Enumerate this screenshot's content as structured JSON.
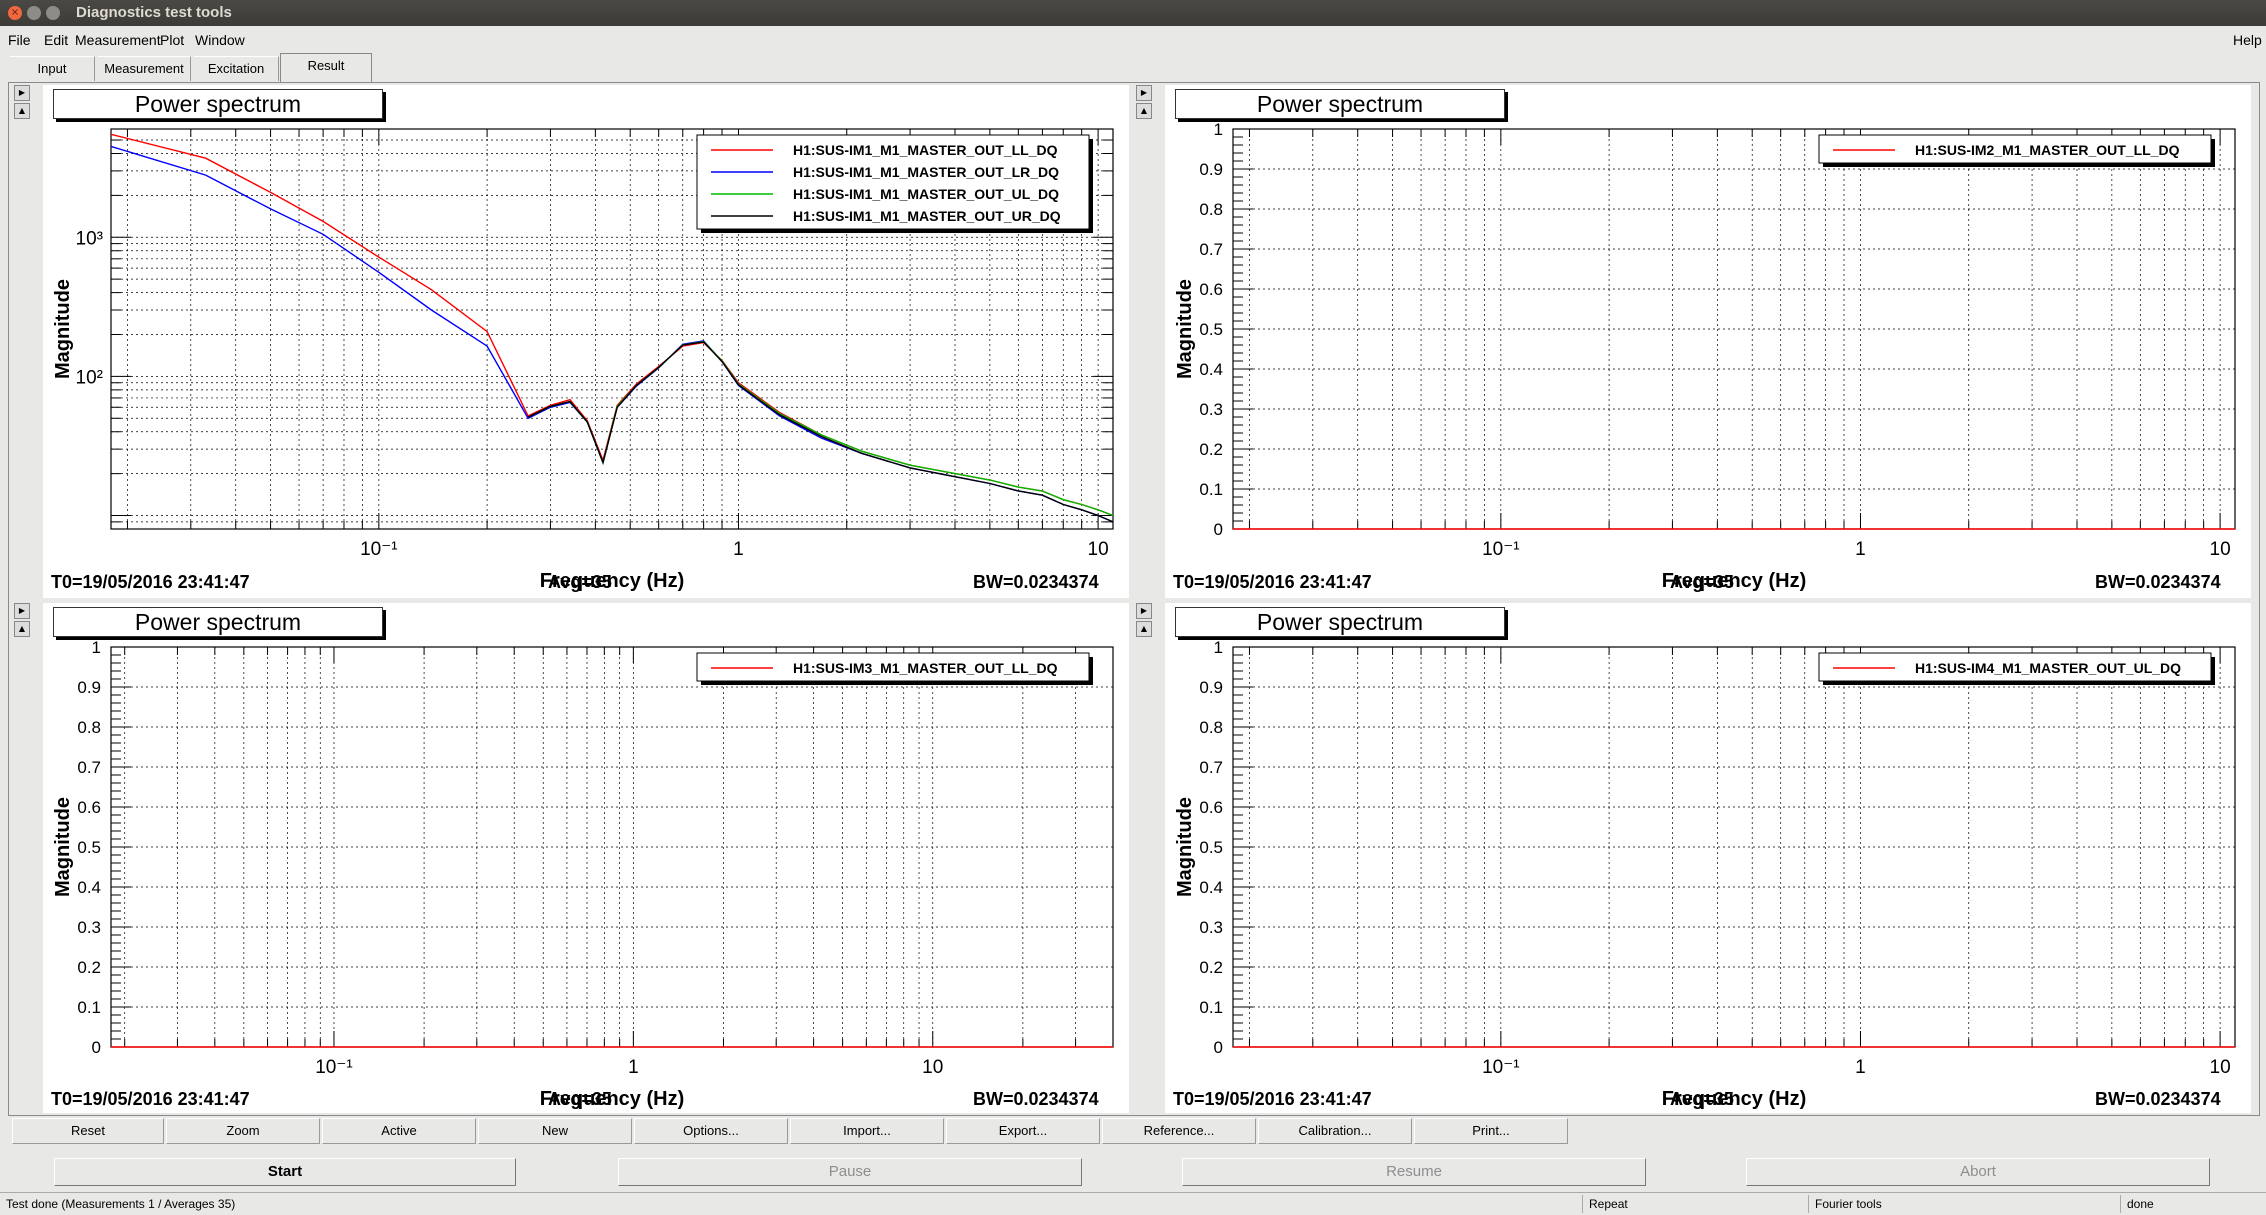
{
  "window": {
    "title": "Diagnostics test tools"
  },
  "menu": {
    "items": [
      "File",
      "Edit",
      "Measurement",
      "Plot",
      "Window"
    ],
    "help": "Help"
  },
  "tabs": [
    "Input",
    "Measurement",
    "Excitation",
    "Result"
  ],
  "active_tab": "Result",
  "pads": [
    {
      "title": "Power spectrum",
      "ylabel": "Magnitude",
      "xlabel": "Frequency (Hz)",
      "t0": "T0=19/05/2016 23:41:47",
      "avg": "Avg=35",
      "bw": "BW=0.0234374",
      "legend": [
        "H1:SUS-IM1_M1_MASTER_OUT_LL_DQ",
        "H1:SUS-IM1_M1_MASTER_OUT_LR_DQ",
        "H1:SUS-IM1_M1_MASTER_OUT_UL_DQ",
        "H1:SUS-IM1_M1_MASTER_OUT_UR_DQ"
      ],
      "xticks": [
        "10⁻¹",
        "1",
        "10"
      ],
      "yticks": [
        "10³",
        "10²"
      ]
    },
    {
      "title": "Power spectrum",
      "ylabel": "Magnitude",
      "xlabel": "Frequency (Hz)",
      "t0": "T0=19/05/2016 23:41:47",
      "avg": "Avg=35",
      "bw": "BW=0.0234374",
      "legend": [
        "H1:SUS-IM2_M1_MASTER_OUT_LL_DQ"
      ],
      "xticks": [
        "10⁻¹",
        "1",
        "10"
      ],
      "yticks": [
        "0",
        "0.1",
        "0.2",
        "0.3",
        "0.4",
        "0.5",
        "0.6",
        "0.7",
        "0.8",
        "0.9",
        "1"
      ]
    },
    {
      "title": "Power spectrum",
      "ylabel": "Magnitude",
      "xlabel": "Frequency (Hz)",
      "t0": "T0=19/05/2016 23:41:47",
      "avg": "Avg=35",
      "bw": "BW=0.0234374",
      "legend": [
        "H1:SUS-IM3_M1_MASTER_OUT_LL_DQ"
      ],
      "xticks": [
        "10⁻¹",
        "1",
        "10"
      ],
      "yticks": [
        "0",
        "0.1",
        "0.2",
        "0.3",
        "0.4",
        "0.5",
        "0.6",
        "0.7",
        "0.8",
        "0.9",
        "1"
      ]
    },
    {
      "title": "Power spectrum",
      "ylabel": "Magnitude",
      "xlabel": "Frequency (Hz)",
      "t0": "T0=19/05/2016 23:41:47",
      "avg": "Avg=35",
      "bw": "BW=0.0234374",
      "legend": [
        "H1:SUS-IM4_M1_MASTER_OUT_UL_DQ"
      ],
      "xticks": [
        "10⁻¹",
        "1",
        "10"
      ],
      "yticks": [
        "0",
        "0.1",
        "0.2",
        "0.3",
        "0.4",
        "0.5",
        "0.6",
        "0.7",
        "0.8",
        "0.9",
        "1"
      ]
    }
  ],
  "chart_data": [
    {
      "type": "line",
      "title": "Power spectrum",
      "xlabel": "Frequency (Hz)",
      "ylabel": "Magnitude",
      "xscale": "log",
      "yscale": "log",
      "xlim": [
        0.018,
        11
      ],
      "ylim": [
        8,
        6000
      ],
      "grid": true,
      "legend_position": "top-right",
      "series": [
        {
          "name": "H1:SUS-IM1_M1_MASTER_OUT_LL_DQ",
          "color": "#ff0000",
          "x": [
            0.018,
            0.033,
            0.05,
            0.07,
            0.1,
            0.14,
            0.2,
            0.26,
            0.3,
            0.34,
            0.38,
            0.42,
            0.46,
            0.52,
            0.6,
            0.7,
            0.8,
            0.9,
            1.0,
            1.3,
            1.7,
            2.2,
            3,
            4,
            5,
            6,
            7,
            8,
            9,
            10,
            11
          ],
          "y": [
            5500,
            3700,
            2100,
            1300,
            720,
            420,
            210,
            52,
            62,
            68,
            48,
            25,
            62,
            88,
            118,
            165,
            175,
            130,
            90,
            55,
            38,
            29,
            23,
            20,
            18,
            16,
            15,
            13,
            12,
            11,
            10
          ]
        },
        {
          "name": "H1:SUS-IM1_M1_MASTER_OUT_LR_DQ",
          "color": "#0000ff",
          "x": [
            0.018,
            0.033,
            0.05,
            0.07,
            0.1,
            0.14,
            0.2,
            0.26,
            0.3,
            0.34,
            0.38,
            0.42,
            0.46,
            0.52,
            0.6,
            0.7,
            0.8,
            0.9,
            1.0,
            1.3,
            1.7,
            2.2,
            3,
            4,
            5,
            6,
            7,
            8,
            9,
            10,
            11
          ],
          "y": [
            4500,
            2800,
            1600,
            1050,
            560,
            300,
            165,
            50,
            60,
            65,
            47,
            24,
            60,
            85,
            115,
            170,
            180,
            128,
            86,
            52,
            36,
            28,
            22,
            19,
            17,
            15,
            14,
            12,
            11,
            10,
            9
          ]
        },
        {
          "name": "H1:SUS-IM1_M1_MASTER_OUT_UL_DQ",
          "color": "#00bb00",
          "x": [
            0.26,
            0.3,
            0.34,
            0.38,
            0.42,
            0.46,
            0.52,
            0.6,
            0.7,
            0.8,
            0.9,
            1.0,
            1.3,
            1.7,
            2.2,
            3,
            4,
            5,
            6,
            7,
            8,
            9,
            10,
            11
          ],
          "y": [
            51,
            61,
            66,
            47,
            24,
            61,
            86,
            116,
            168,
            178,
            129,
            88,
            54,
            38,
            29,
            23,
            20,
            18,
            16,
            15,
            13,
            12,
            11,
            10
          ]
        },
        {
          "name": "H1:SUS-IM1_M1_MASTER_OUT_UR_DQ",
          "color": "#000000",
          "x": [
            0.26,
            0.3,
            0.34,
            0.38,
            0.42,
            0.46,
            0.52,
            0.6,
            0.7,
            0.8,
            0.9,
            1.0,
            1.3,
            1.7,
            2.2,
            3,
            4,
            5,
            6,
            7,
            8,
            9,
            10,
            11
          ],
          "y": [
            51,
            61,
            66,
            47,
            24,
            60,
            86,
            116,
            168,
            177,
            128,
            87,
            53,
            37,
            28,
            22,
            19,
            17,
            15,
            14,
            12,
            11,
            10,
            9
          ]
        }
      ]
    },
    {
      "type": "line",
      "title": "Power spectrum",
      "xlabel": "Frequency (Hz)",
      "ylabel": "Magnitude",
      "xscale": "log",
      "xlim": [
        0.018,
        11
      ],
      "ylim": [
        0,
        1
      ],
      "grid": true,
      "legend_position": "top-right",
      "series": [
        {
          "name": "H1:SUS-IM2_M1_MASTER_OUT_LL_DQ",
          "color": "#ff0000",
          "x": [
            0.018,
            11
          ],
          "y": [
            0,
            0
          ]
        }
      ]
    },
    {
      "type": "line",
      "title": "Power spectrum",
      "xlabel": "Frequency (Hz)",
      "ylabel": "Magnitude",
      "xscale": "log",
      "xlim": [
        0.018,
        40
      ],
      "ylim": [
        0,
        1
      ],
      "grid": true,
      "legend_position": "top-right",
      "series": [
        {
          "name": "H1:SUS-IM3_M1_MASTER_OUT_LL_DQ",
          "color": "#ff0000",
          "x": [
            0.018,
            40
          ],
          "y": [
            0,
            0
          ]
        }
      ]
    },
    {
      "type": "line",
      "title": "Power spectrum",
      "xlabel": "Frequency (Hz)",
      "ylabel": "Magnitude",
      "xscale": "log",
      "xlim": [
        0.018,
        11
      ],
      "ylim": [
        0,
        1
      ],
      "grid": true,
      "legend_position": "top-right",
      "series": [
        {
          "name": "H1:SUS-IM4_M1_MASTER_OUT_UL_DQ",
          "color": "#ff0000",
          "x": [
            0.018,
            11
          ],
          "y": [
            0,
            0
          ]
        }
      ]
    }
  ],
  "toolbar": [
    "Reset",
    "Zoom",
    "Active",
    "New",
    "Options...",
    "Import...",
    "Export...",
    "Reference...",
    "Calibration...",
    "Print..."
  ],
  "controls": [
    "Start",
    "Pause",
    "Resume",
    "Abort"
  ],
  "status": {
    "message": "Test done (Measurements 1 / Averages 35)",
    "repeat": "Repeat",
    "tools": "Fourier tools",
    "state": "done"
  }
}
